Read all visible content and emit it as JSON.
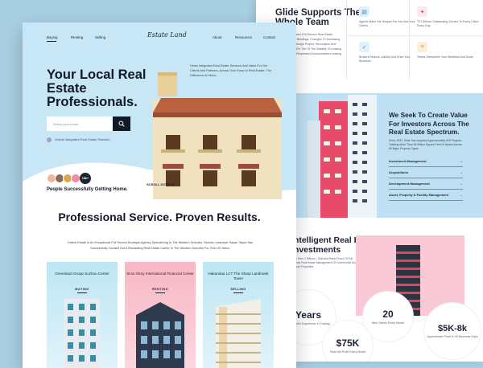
{
  "back": {
    "glide_title": "Glide Supports The Whole Team",
    "glide_text": "Our Fully Integrated Full-Service Real Estate Management Of Buildings, Changes To Increasing Stock Leasing, Design Project, Renovation And Leasing Up To 20% The Of The Stability Of Leasing To Be Added To Requested Documentation Leasing Services.",
    "features": [
      {
        "icon": "clipboard-icon",
        "color": "#dff1fb",
        "text": "Agents Make Life Simpler For You And Your Clients"
      },
      {
        "icon": "bulb-icon",
        "color": "#fbe8f1",
        "text": "TCI Deliver Outstanding Service To Every Client Every Day"
      },
      {
        "icon": "check-icon",
        "color": "#fcf2df",
        "text": "Brokers Reduce Liability And Drive Your Business"
      },
      {
        "icon": "stack-icon",
        "color": "#fbe8e3",
        "text": "Teams Streamline Your Workflow And Scale"
      }
    ],
    "seek_title": "We Seek To Create Value For Investors Across The Real Estate Spectrum.",
    "seek_text": "Since 1992, Glide Has Acquired Approximately 500 Projects Totalling More Than 35 Million Square Feet Of Space Across All Major Property Types.",
    "seek_items": [
      "Investment Management",
      "Acquisitions",
      "Development Management",
      "Asset, Property & Facility Management"
    ],
    "inv_title": "Intelligent Real Estate Investments",
    "inv_text": "With Over 2 Billions - Sold And Rank Proud Of Full-Service Real Estate Management Of Commercial And Secure Properties",
    "stats": [
      {
        "value": "Years",
        "label": "Successful Experience In Trading"
      },
      {
        "value": "20",
        "label": "New Clients Every Month"
      },
      {
        "value": "$5K-8k",
        "label": "Approximate Profit In 30 Business Days"
      },
      {
        "value": "$75K",
        "label": "Total Net Profit Every Month"
      }
    ]
  },
  "front": {
    "nav": {
      "items": [
        "Buying",
        "Renting",
        "Selling",
        "About",
        "Resources",
        "Contact"
      ],
      "logo": "Estate Land"
    },
    "hero_title": "Your Local Real Estate Professionals.",
    "search_placeholder": "Select your home",
    "hero_sub": "Global Integrated Real Estate Platform",
    "hero_desc": "Hines Integrated Real Estate Services Add Value For Our Clients And Partners, Across Own Know In Real Estate. The Difference At Hines.",
    "avatar_count": "18k+",
    "people_text": "People Successfully Getting Home.",
    "scroll": "SCROLL DOWN",
    "prof_title": "Professional Service. Proven Results.",
    "prof_text": "Galera Estate Is An Exceptional Full Service Boutique Agency Specializing In The Western Suburbs, Director Lisanawe Sayan Taylor Has Successfully Curated Out A Rewarding Real Estate Career In The Western Suburbs For Over 20 Years.",
    "cards": [
      {
        "title": "Greenland Group Suzhou Center",
        "badge": "BUYING"
      },
      {
        "title": "Si'an Glory International Financial Center",
        "badge": "RENTING"
      },
      {
        "title": "Hakandaa LCT The Sharp Landmark Tower",
        "badge": "SELLING"
      }
    ]
  },
  "colors": {
    "accent": "#111827",
    "sky": "#c7e6f6",
    "pink": "#f6b6c8"
  }
}
